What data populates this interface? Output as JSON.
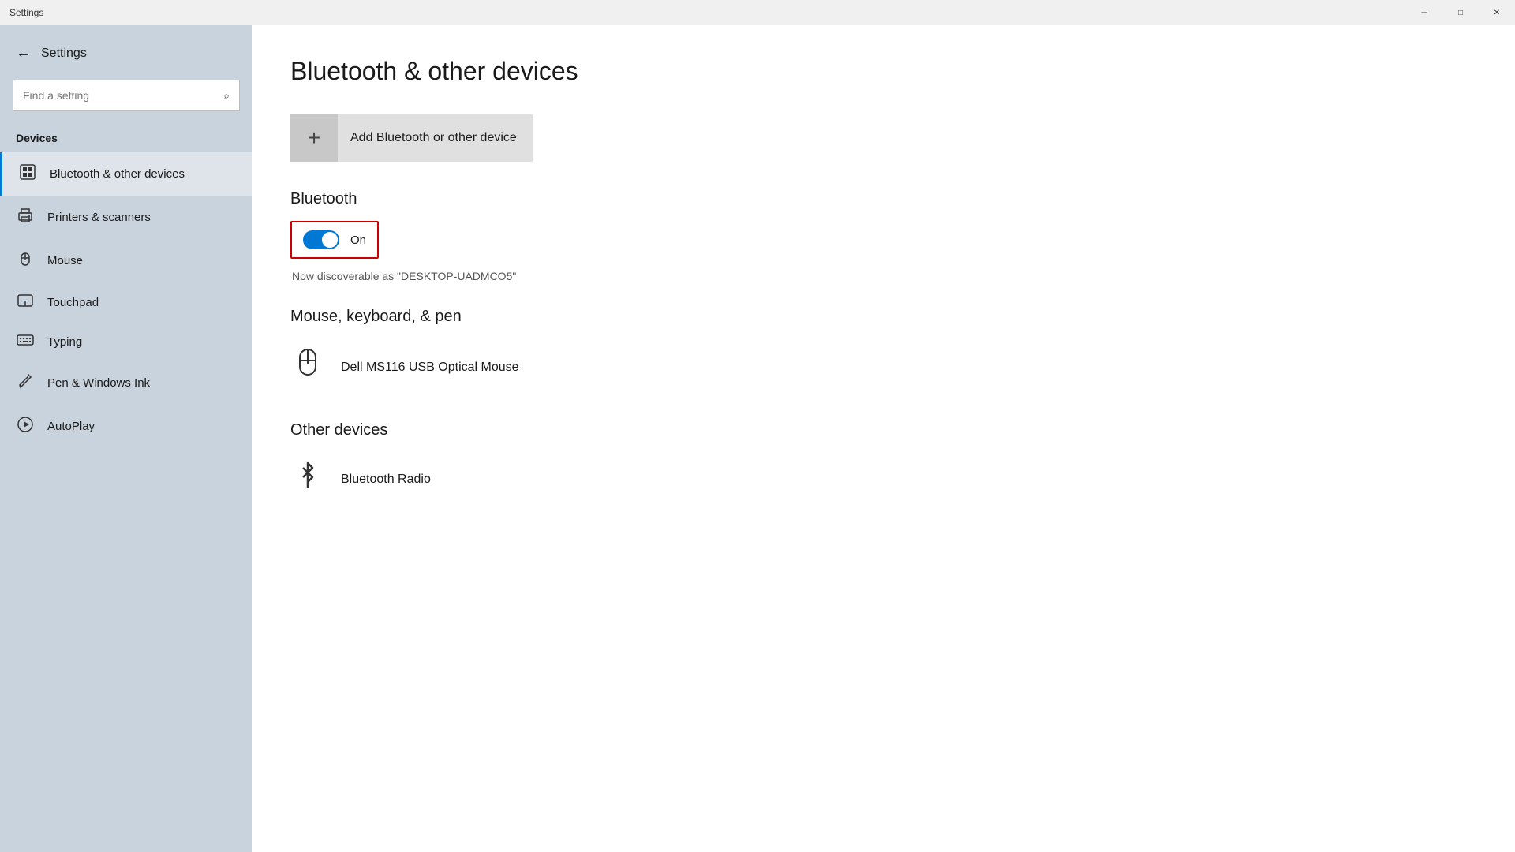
{
  "titlebar": {
    "title": "Settings",
    "minimize_label": "─",
    "maximize_label": "□",
    "close_label": "✕"
  },
  "sidebar": {
    "back_icon": "←",
    "search_placeholder": "Find a setting",
    "search_icon": "⌕",
    "section_label": "Devices",
    "items": [
      {
        "id": "bluetooth",
        "label": "Bluetooth & other devices",
        "icon": "⊞",
        "active": true
      },
      {
        "id": "printers",
        "label": "Printers & scanners",
        "icon": "🖨",
        "active": false
      },
      {
        "id": "mouse",
        "label": "Mouse",
        "icon": "🖱",
        "active": false
      },
      {
        "id": "touchpad",
        "label": "Touchpad",
        "icon": "⬜",
        "active": false
      },
      {
        "id": "typing",
        "label": "Typing",
        "icon": "⌨",
        "active": false
      },
      {
        "id": "pen",
        "label": "Pen & Windows Ink",
        "icon": "✒",
        "active": false
      },
      {
        "id": "autoplay",
        "label": "AutoPlay",
        "icon": "▶",
        "active": false
      }
    ]
  },
  "main": {
    "page_title": "Bluetooth & other devices",
    "add_device_label": "Add Bluetooth or other device",
    "bluetooth_section_title": "Bluetooth",
    "bluetooth_toggle_label": "On",
    "bluetooth_discoverable": "Now discoverable as \"DESKTOP-UADMCO5\"",
    "mouse_section_title": "Mouse, keyboard, & pen",
    "mouse_device_name": "Dell MS116 USB Optical Mouse",
    "other_section_title": "Other devices",
    "other_device_name": "Bluetooth Radio"
  },
  "colors": {
    "sidebar_bg": "#c8d3dd",
    "toggle_on": "#0078d4",
    "active_border": "#0078d4",
    "highlight_border": "#cc0000"
  }
}
